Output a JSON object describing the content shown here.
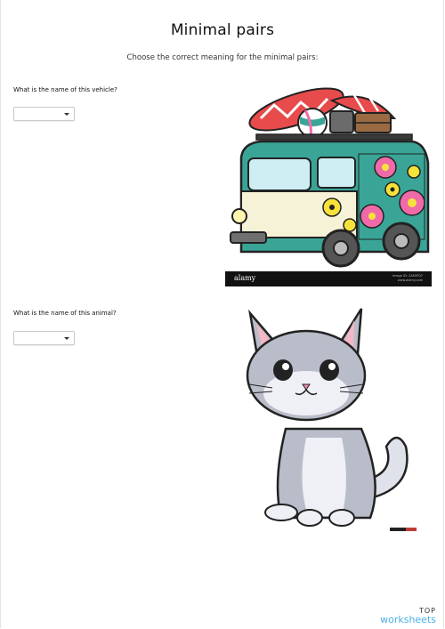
{
  "worksheet": {
    "title": "Minimal pairs",
    "instructions": "Choose the correct meaning for the minimal pairs:",
    "questions": [
      {
        "text": "What is the name of this vehicle?",
        "selected_value": "",
        "image": "hippie-van-illustration"
      },
      {
        "text": "What is the name of this animal?",
        "selected_value": "",
        "image": "cat-illustration"
      }
    ]
  },
  "van_image": {
    "watermark_logo": "alamy",
    "image_id": "Image ID: 2AE0FD7",
    "site": "www.alamy.com"
  },
  "branding": {
    "line1": "TOP",
    "line2": "worksheets",
    "color": "#4cb0e6"
  },
  "colors": {
    "van_teal": "#3aa597",
    "flower_pink": "#f06aa9",
    "flower_yellow": "#f7e23a",
    "surfboard_red": "#e84b4b",
    "cat_gray": "#b9bdc9"
  }
}
